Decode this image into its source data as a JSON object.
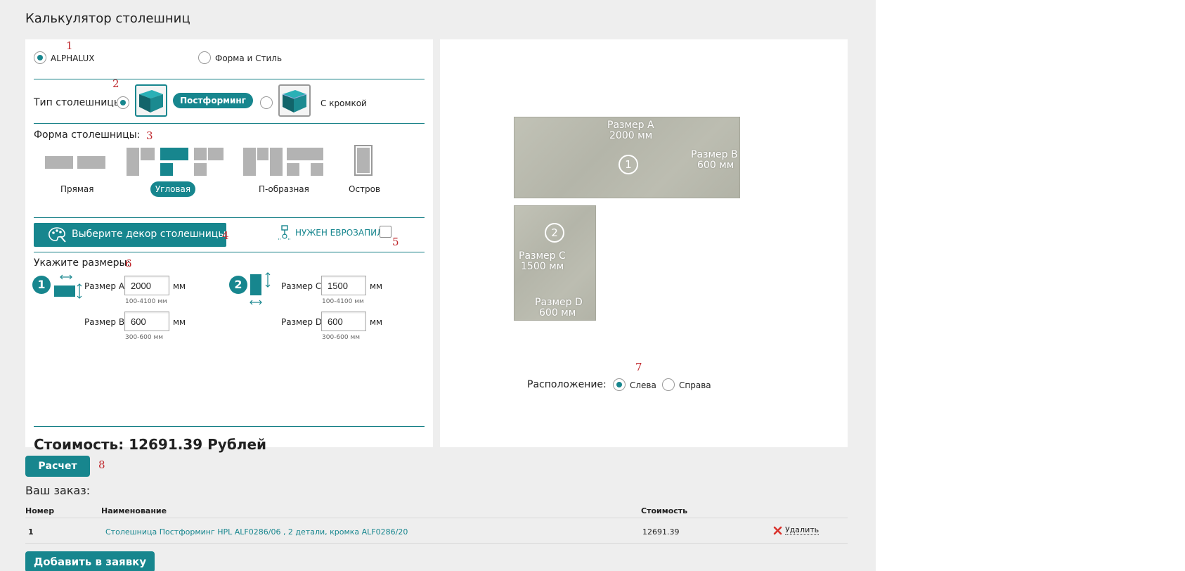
{
  "page": {
    "title": "Калькулятор столешниц"
  },
  "markers": [
    "1",
    "2",
    "3",
    "4",
    "5",
    "6",
    "7",
    "8"
  ],
  "brand": {
    "option1": "ALPHALUX",
    "option2": "Форма и Стиль",
    "selected": "ALPHALUX"
  },
  "type": {
    "label": "Тип столешницы:",
    "option1": "Постформинг HPL",
    "option2": "С кромкой",
    "selected": "Постформинг HPL"
  },
  "shape": {
    "label": "Форма столешницы:",
    "options": [
      "Прямая",
      "Угловая",
      "П-образная",
      "Остров"
    ],
    "selected": "Угловая"
  },
  "decor": {
    "button_label": "Выберите декор столешницы",
    "eurozapil_label": "НУЖЕН ЕВРОЗАПИЛ",
    "eurozapil_checked": false
  },
  "sizes": {
    "label": "Укажите размеры:",
    "unit": "мм",
    "part1": {
      "number": "1",
      "a_label": "Размер A",
      "a_value": "2000",
      "a_hint": "100-4100 мм",
      "b_label": "Размер B",
      "b_value": "600",
      "b_hint": "300-600 мм"
    },
    "part2": {
      "number": "2",
      "c_label": "Размер C",
      "c_value": "1500",
      "c_hint": "100-4100 мм",
      "d_label": "Размер D",
      "d_value": "600",
      "d_hint": "300-600 мм"
    }
  },
  "preview": {
    "slab1": {
      "num": "1",
      "a_label": "Размер A",
      "a_value": "2000 мм",
      "b_label": "Размер B",
      "b_value": "600 мм"
    },
    "slab2": {
      "num": "2",
      "c_label": "Размер C",
      "c_value": "1500 мм",
      "d_label": "Размер D",
      "d_value": "600 мм"
    },
    "position_label": "Расположение:",
    "position_left": "Слева",
    "position_right": "Справа",
    "position_selected": "Слева"
  },
  "cost": {
    "text": "Стоимость: 12691.39 Рублей"
  },
  "calc_button": "Расчет",
  "order": {
    "title": "Ваш заказ:",
    "headers": {
      "number": "Номер",
      "name": "Наименование",
      "cost": "Стоимость"
    },
    "rows": [
      {
        "number": "1",
        "name": "Столешница Постформинг HPL ALF0286/06 , 2 детали, кромка ALF0286/20",
        "cost": "12691.39",
        "delete": "Удалить"
      }
    ]
  },
  "add_button": "Добавить в заявку",
  "colors": {
    "accent": "#17868e",
    "marker": "#c0282d",
    "slab": "#b9baae"
  }
}
